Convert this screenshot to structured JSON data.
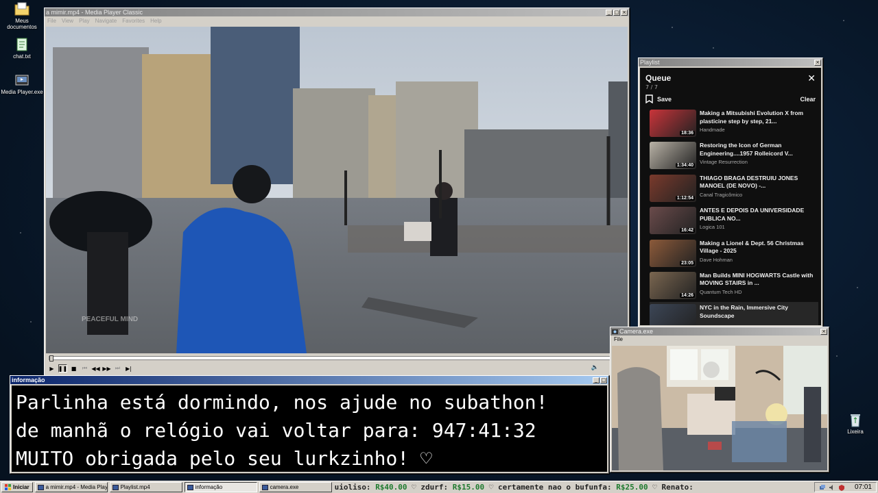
{
  "desktop": {
    "icons": [
      {
        "label": "Meus documentos",
        "icon": "folder-icon"
      },
      {
        "label": "chat.txt",
        "icon": "notepad-icon"
      },
      {
        "label": "Media Player.exe",
        "icon": "media-player-icon"
      },
      {
        "label": "Lixeira",
        "icon": "recycle-bin-icon"
      }
    ]
  },
  "media_player": {
    "title": "a mimir.mp4 - Media Player Classic",
    "menu": [
      "File",
      "View",
      "Play",
      "Navigate",
      "Favorites",
      "Help"
    ],
    "watermark": "PEACEFUL MIND",
    "progress": 0.0,
    "controls": {
      "play": "▶",
      "pause": "❚❚",
      "stop": "■",
      "prev": "⏮",
      "rew": "◀◀",
      "fwd": "▶▶",
      "next": "⏭",
      "frame": "▶|",
      "volume": "🔈"
    }
  },
  "playlist": {
    "window_title": "Playlist",
    "heading": "Queue",
    "count": "7 / 7",
    "save_label": "Save",
    "clear_label": "Clear",
    "close_glyph": "✕",
    "items": [
      {
        "title": "Making a Mitsubishi Evolution X from plasticine step by step, 21...",
        "channel": "Handmade",
        "duration": "18:36",
        "thumb_color": "#c9343a"
      },
      {
        "title": "Restoring the Icon of German Engineering....1957 Rolleicord V...",
        "channel": "Vintage Resurrection",
        "duration": "1:34:40",
        "thumb_color": "#b9b2a6"
      },
      {
        "title": "THIAGO BRAGA DESTRUIU JONES MANOEL (DE NOVO) -...",
        "channel": "Canal Tragicômico",
        "duration": "1:12:54",
        "thumb_color": "#7a3a2c"
      },
      {
        "title": "ANTES E DEPOIS DA UNIVERSIDADE PUBLICA NO...",
        "channel": "Logica 101",
        "duration": "16:42",
        "thumb_color": "#6a4b4b"
      },
      {
        "title": "Making a Lionel & Dept. 56 Christmas Village - 2025",
        "channel": "Dave Hohman",
        "duration": "23:05",
        "thumb_color": "#8c5a3a"
      },
      {
        "title": "Man Builds MINI HOGWARTS Castle with MOVING STAIRS in ...",
        "channel": "Quantum Tech HD",
        "duration": "14:26",
        "thumb_color": "#7a6650"
      },
      {
        "title": "NYC in the Rain, Immersive City Soundscape",
        "channel": "",
        "duration": "",
        "thumb_color": "#3c4656"
      }
    ]
  },
  "camera": {
    "title": "Camera.exe",
    "menu": "File"
  },
  "info": {
    "title": "informação",
    "lines": [
      "Parlinha está dormindo, nos ajude no subathon!",
      "de manhã o relógio vai voltar para:  947:41:32",
      "MUITO obrigada pelo seu lurkzinho! ♡"
    ]
  },
  "taskbar": {
    "start_label": "Iniciar",
    "tasks": [
      {
        "label": "a mimir.mp4 - Media Playe...",
        "pressed": false
      },
      {
        "label": "Playlist.mp4",
        "pressed": false
      },
      {
        "label": "informação",
        "pressed": true
      },
      {
        "label": "camera.exe",
        "pressed": false
      }
    ],
    "ticker": [
      {
        "name": "uioliso:",
        "amount": "R$40.00"
      },
      {
        "name": "zdurf:",
        "amount": "R$15.00"
      },
      {
        "name": "certamente nao o bufunfa:",
        "amount": "R$25.00"
      },
      {
        "name": "Renato:",
        "amount": ""
      }
    ],
    "ticker_sep": "♡",
    "clock": "07:01"
  },
  "colors": {
    "title_active": "#0a246a",
    "title_inactive": "#808080",
    "window_face": "#d4d0c8",
    "playlist_bg": "#0f0f0f",
    "donation_green": "#1e7a2e"
  }
}
